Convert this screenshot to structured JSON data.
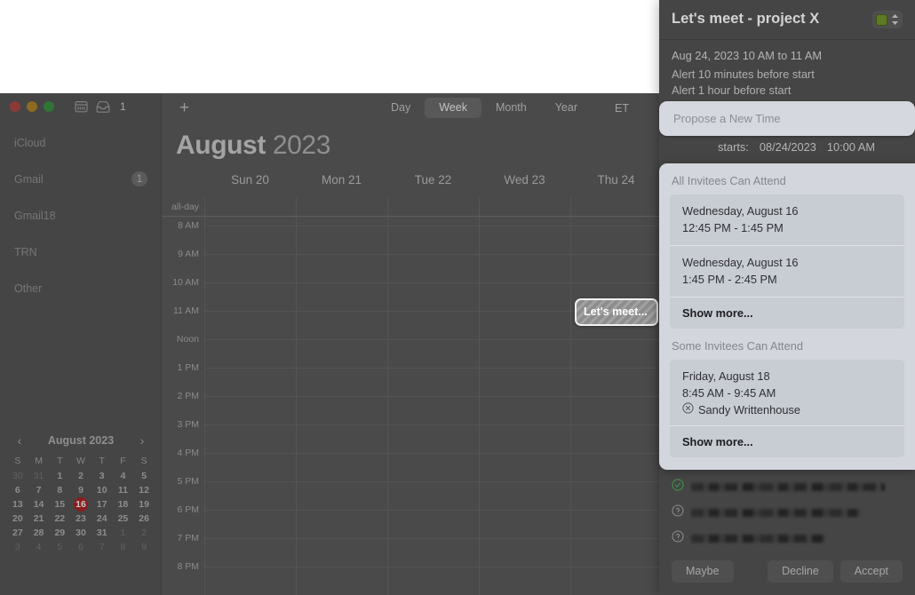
{
  "window": {
    "traffic_lights": [
      "close",
      "minimize",
      "zoom"
    ],
    "inbox_count": "1"
  },
  "sidebar": {
    "accounts": [
      {
        "label": "iCloud",
        "badge": ""
      },
      {
        "label": "Gmail",
        "badge": "1"
      },
      {
        "label": "Gmail18",
        "badge": ""
      },
      {
        "label": "TRN",
        "badge": ""
      },
      {
        "label": "Other",
        "badge": ""
      }
    ]
  },
  "mini_calendar": {
    "title": "August 2023",
    "prev_arrow": "‹",
    "next_arrow": "›",
    "dow": [
      "S",
      "M",
      "T",
      "W",
      "T",
      "F",
      "S"
    ],
    "today": 16,
    "weeks": [
      [
        {
          "d": "30",
          "out": true
        },
        {
          "d": "31",
          "out": true
        },
        {
          "d": "1"
        },
        {
          "d": "2"
        },
        {
          "d": "3"
        },
        {
          "d": "4"
        },
        {
          "d": "5"
        }
      ],
      [
        {
          "d": "6"
        },
        {
          "d": "7"
        },
        {
          "d": "8"
        },
        {
          "d": "9"
        },
        {
          "d": "10"
        },
        {
          "d": "11"
        },
        {
          "d": "12"
        }
      ],
      [
        {
          "d": "13"
        },
        {
          "d": "14"
        },
        {
          "d": "15"
        },
        {
          "d": "16",
          "today": true
        },
        {
          "d": "17"
        },
        {
          "d": "18"
        },
        {
          "d": "19"
        }
      ],
      [
        {
          "d": "20"
        },
        {
          "d": "21"
        },
        {
          "d": "22"
        },
        {
          "d": "23"
        },
        {
          "d": "24"
        },
        {
          "d": "25"
        },
        {
          "d": "26"
        }
      ],
      [
        {
          "d": "27"
        },
        {
          "d": "28"
        },
        {
          "d": "29"
        },
        {
          "d": "30"
        },
        {
          "d": "31"
        },
        {
          "d": "1",
          "out": true
        },
        {
          "d": "2",
          "out": true
        }
      ],
      [
        {
          "d": "3",
          "out": true
        },
        {
          "d": "4",
          "out": true
        },
        {
          "d": "5",
          "out": true
        },
        {
          "d": "6",
          "out": true
        },
        {
          "d": "7",
          "out": true
        },
        {
          "d": "8",
          "out": true
        },
        {
          "d": "9",
          "out": true
        }
      ]
    ]
  },
  "toolbar": {
    "add_label": "+",
    "views": [
      "Day",
      "Week",
      "Month",
      "Year"
    ],
    "active_view": "Week",
    "timezone": "ET"
  },
  "calendar": {
    "month": "August",
    "year": "2023",
    "all_day_label": "all-day",
    "days": [
      "Sun 20",
      "Mon 21",
      "Tue 22",
      "Wed 23",
      "Thu 24"
    ],
    "hours": [
      "8 AM",
      "9 AM",
      "10 AM",
      "11 AM",
      "Noon",
      "1 PM",
      "2 PM",
      "3 PM",
      "4 PM",
      "5 PM",
      "6 PM",
      "7 PM",
      "8 PM"
    ],
    "events": [
      {
        "title": "Let's meet...",
        "day_index": 4,
        "start_hour_index": 2
      }
    ]
  },
  "popup": {
    "title": "Let's meet - project X",
    "calendar_color": "#5f7a24",
    "date_line": "Aug 24, 2023  10 AM to 11 AM",
    "alerts": [
      "Alert 10 minutes before start",
      "Alert 1 hour before start"
    ],
    "propose_placeholder": "Propose a New Time",
    "starts_label": "starts:",
    "starts_date": "08/24/2023",
    "starts_time": "10:00 AM",
    "invitees": [
      {
        "status": "accepted"
      },
      {
        "status": "pending"
      },
      {
        "status": "pending"
      }
    ],
    "buttons": {
      "maybe": "Maybe",
      "decline": "Decline",
      "accept": "Accept"
    }
  },
  "suggestions": {
    "groups": [
      {
        "heading": "All Invitees Can Attend",
        "items": [
          {
            "date": "Wednesday, August 16",
            "time": "12:45 PM - 1:45 PM",
            "conflict": ""
          },
          {
            "date": "Wednesday, August 16",
            "time": "1:45 PM - 2:45 PM",
            "conflict": ""
          }
        ],
        "show_more": "Show more..."
      },
      {
        "heading": "Some Invitees Can Attend",
        "items": [
          {
            "date": "Friday, August 18",
            "time": "8:45 AM - 9:45 AM",
            "conflict": "Sandy Writtenhouse"
          }
        ],
        "show_more": "Show more..."
      }
    ]
  }
}
